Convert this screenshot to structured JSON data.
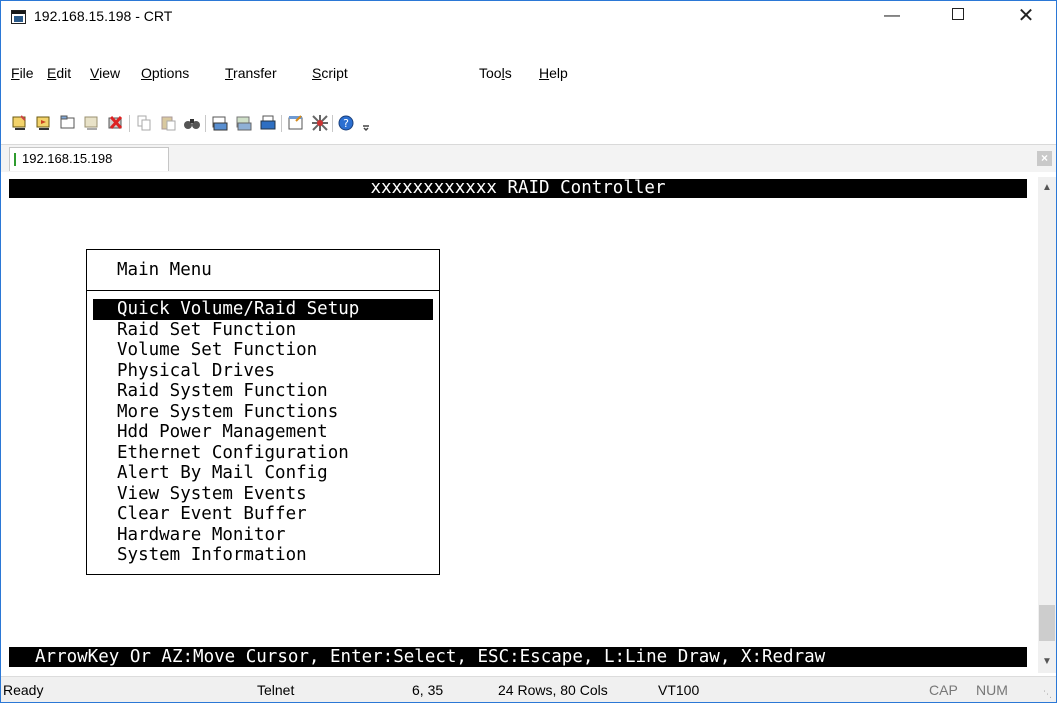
{
  "window": {
    "title": "192.168.15.198 - CRT",
    "minimize": "—",
    "close": "✕"
  },
  "menubar": {
    "items": [
      {
        "pre": "",
        "key": "F",
        "post": "ile"
      },
      {
        "pre": "",
        "key": "E",
        "post": "dit"
      },
      {
        "pre": "",
        "key": "V",
        "post": "iew"
      },
      {
        "pre": "",
        "key": "O",
        "post": "ptions"
      },
      {
        "pre": "",
        "key": "T",
        "post": "ransfer"
      },
      {
        "pre": "",
        "key": "S",
        "post": "cript"
      },
      {
        "pre": "Too",
        "key": "l",
        "post": "s"
      },
      {
        "pre": "",
        "key": "H",
        "post": "elp"
      }
    ]
  },
  "toolbar": {
    "icons": [
      "connect-icon",
      "quick-connect-icon",
      "connect-tab-icon",
      "reconnect-icon",
      "disconnect-icon",
      "copy-icon",
      "paste-icon",
      "find-icon",
      "print-icon",
      "print-selection-icon",
      "printer-icon",
      "session-options-icon",
      "global-options-icon",
      "help-icon",
      "toolbar-overflow-icon"
    ]
  },
  "tab": {
    "label": "192.168.15.198",
    "close": "×"
  },
  "terminal": {
    "header": "xxxxxxxxxxxx RAID Controller",
    "menu_title": "Main Menu",
    "menu_items": [
      "Quick Volume/Raid Setup",
      "Raid Set Function",
      "Volume Set Function",
      "Physical Drives",
      "Raid System Function",
      "More System Functions",
      "Hdd Power Management",
      "Ethernet Configuration",
      "Alert By Mail Config",
      "View System Events",
      "Clear Event Buffer",
      "Hardware Monitor",
      "System Information"
    ],
    "selected_index": 0,
    "hint": "ArrowKey Or AZ:Move Cursor, Enter:Select, ESC:Escape, L:Line Draw, X:Redraw"
  },
  "statusbar": {
    "ready": "Ready",
    "protocol": "Telnet",
    "cursor": "6, 35",
    "size": "24 Rows, 80 Cols",
    "emulation": "VT100",
    "cap": "CAP",
    "num": "NUM"
  }
}
